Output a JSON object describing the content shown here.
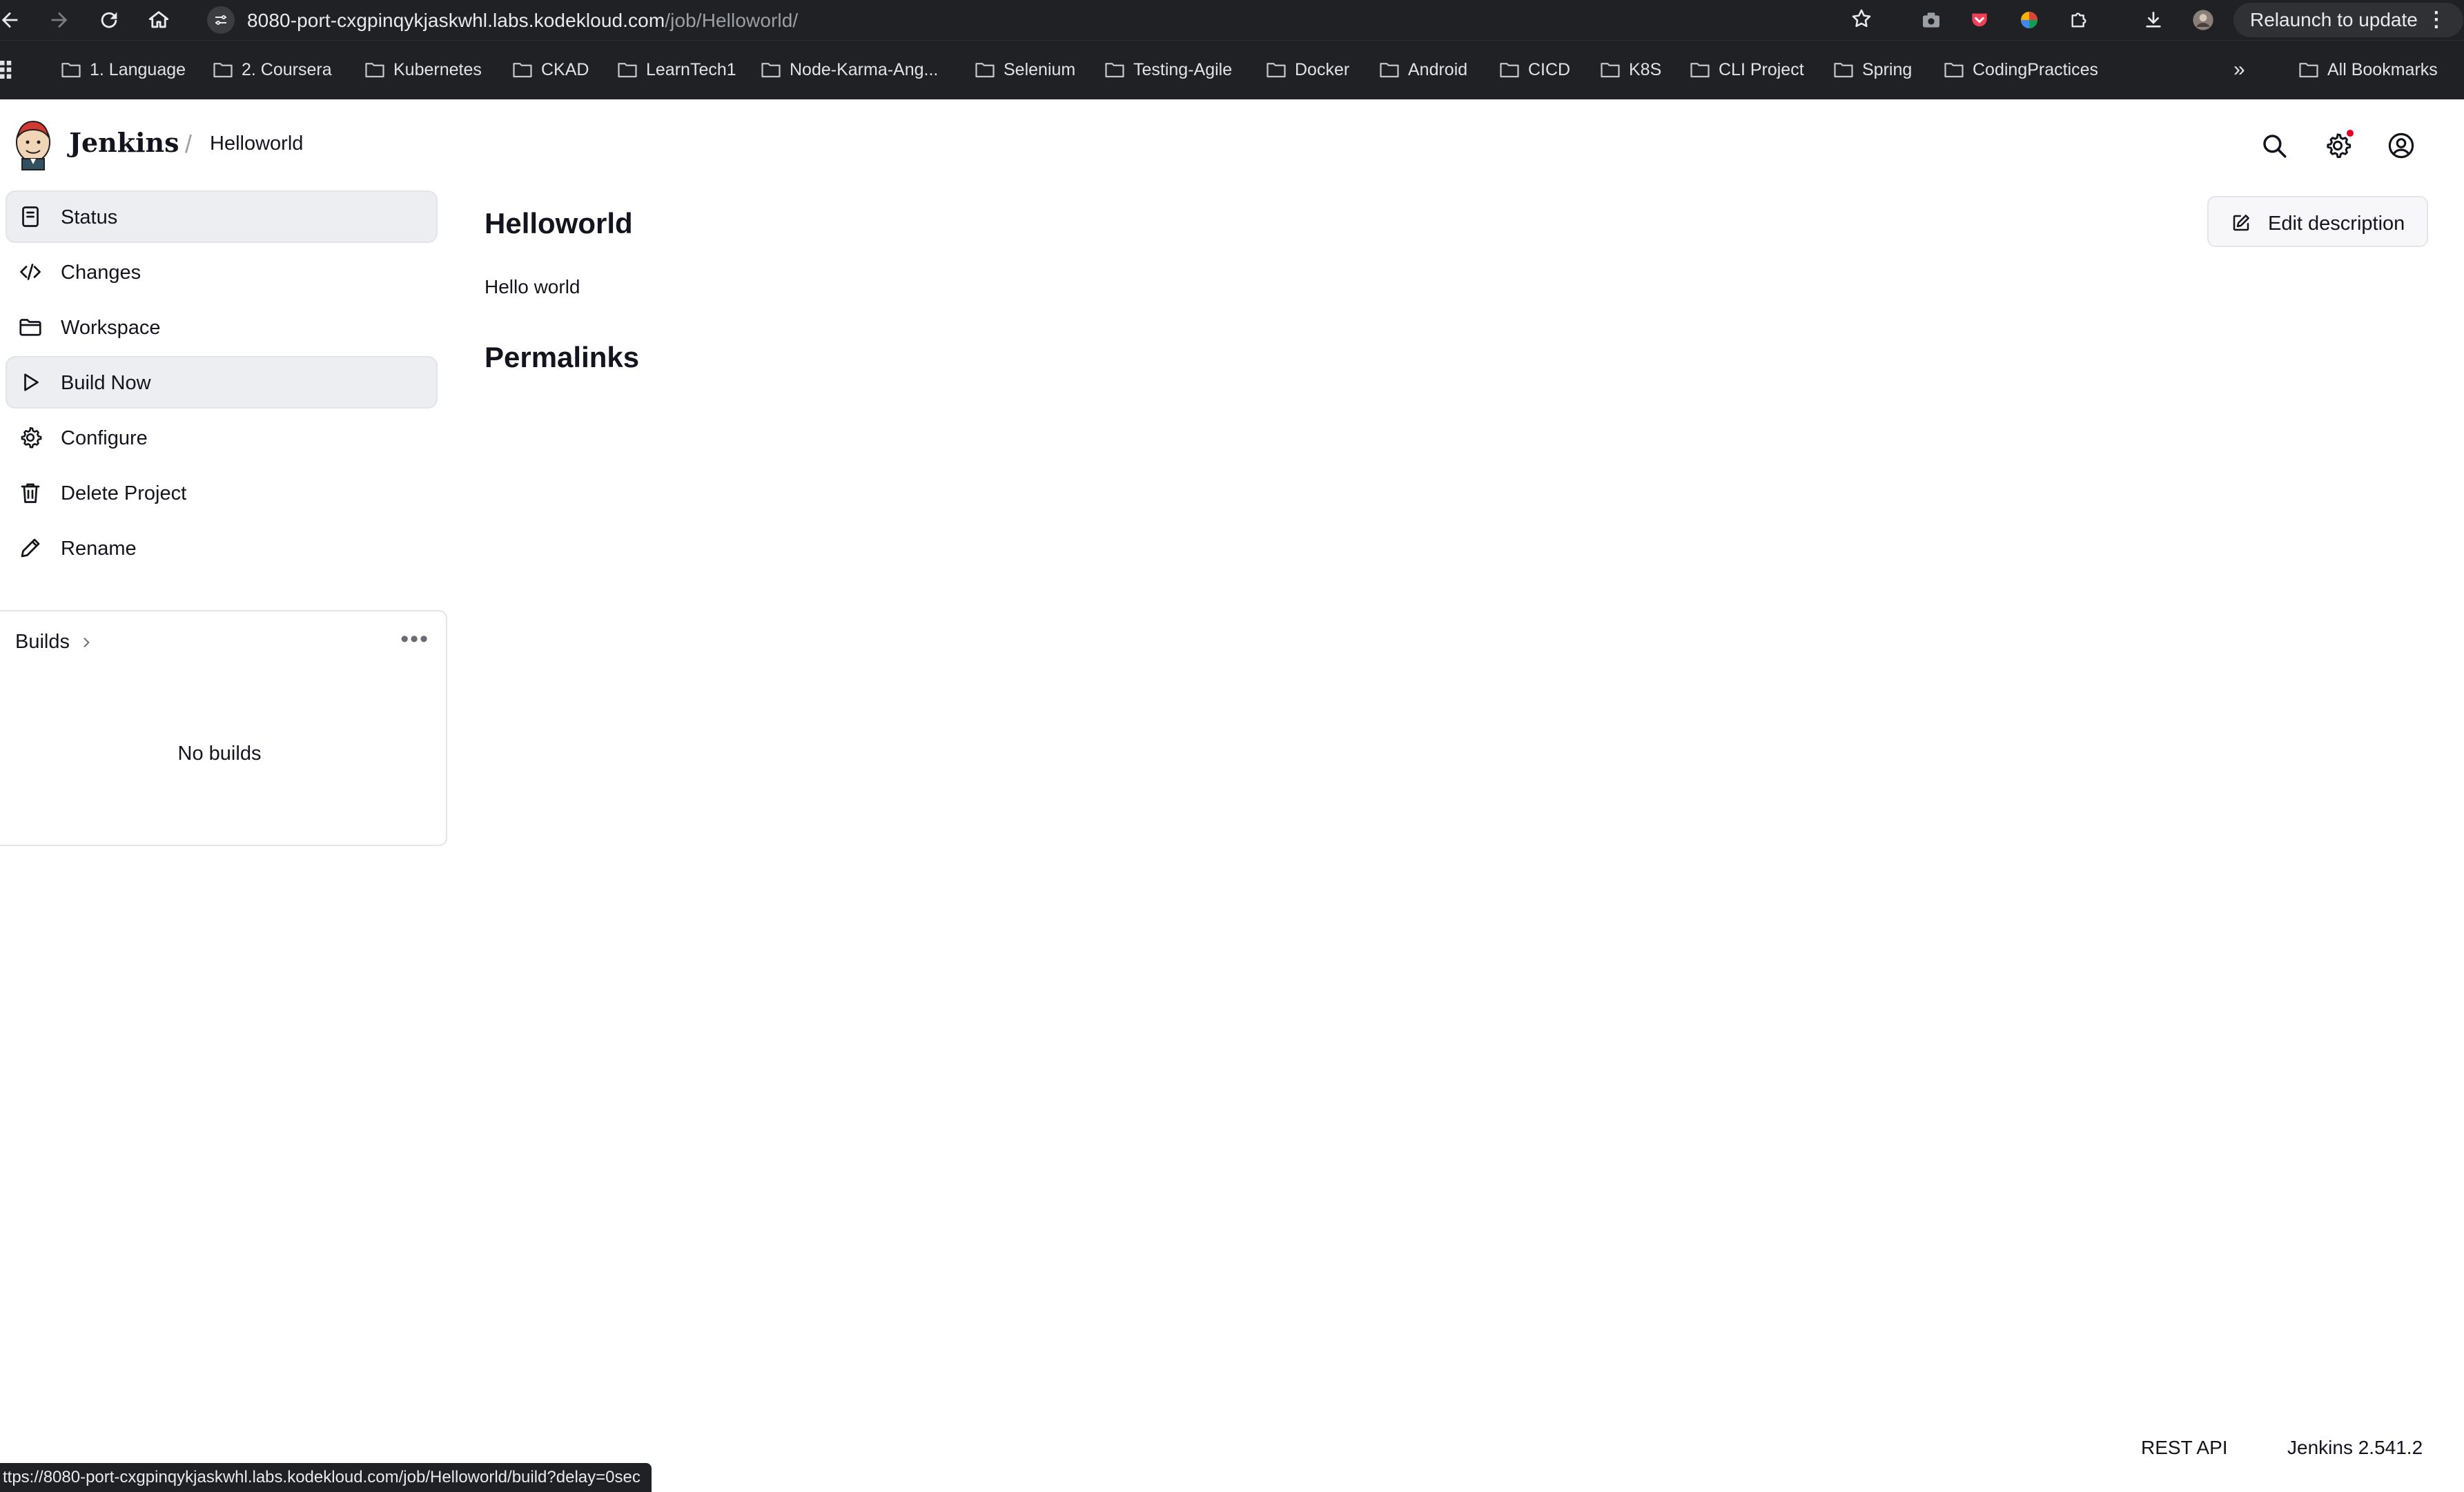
{
  "browser": {
    "url_host": "8080-port-cxgpinqykjaskwhl.labs.kodekloud.com",
    "url_path": "/job/Helloworld/",
    "relaunch_label": "Relaunch to update",
    "bookmarks": [
      "1. Language",
      "2. Coursera",
      "Kubernetes",
      "CKAD",
      "LearnTech1",
      "Node-Karma-Ang...",
      "Selenium",
      "Testing-Agile",
      "Docker",
      "Android",
      "CICD",
      "K8S",
      "CLI Project",
      "Spring",
      "CodingPractices"
    ],
    "all_bookmarks_label": "All Bookmarks",
    "status_url": "ttps://8080-port-cxgpinqykjaskwhl.labs.kodekloud.com/job/Helloworld/build?delay=0sec"
  },
  "header": {
    "brand": "Jenkins",
    "separator": "/",
    "breadcrumb": "Helloworld"
  },
  "sidebar": {
    "items": [
      {
        "label": "Status",
        "icon": "document-icon"
      },
      {
        "label": "Changes",
        "icon": "code-icon"
      },
      {
        "label": "Workspace",
        "icon": "folder-icon"
      },
      {
        "label": "Build Now",
        "icon": "play-icon"
      },
      {
        "label": "Configure",
        "icon": "gear-icon"
      },
      {
        "label": "Delete Project",
        "icon": "trash-icon"
      },
      {
        "label": "Rename",
        "icon": "pencil-icon"
      }
    ]
  },
  "builds": {
    "title": "Builds",
    "more": "•••",
    "empty": "No builds"
  },
  "main": {
    "title": "Helloworld",
    "description": "Hello world",
    "permalinks_heading": "Permalinks",
    "edit_description_label": "Edit description"
  },
  "footer": {
    "rest_api": "REST API",
    "version": "Jenkins 2.541.2"
  },
  "colors": {
    "chrome_bg": "#202124",
    "active_item_bg": "#eceef2",
    "notification_dot": "#e6001f"
  }
}
